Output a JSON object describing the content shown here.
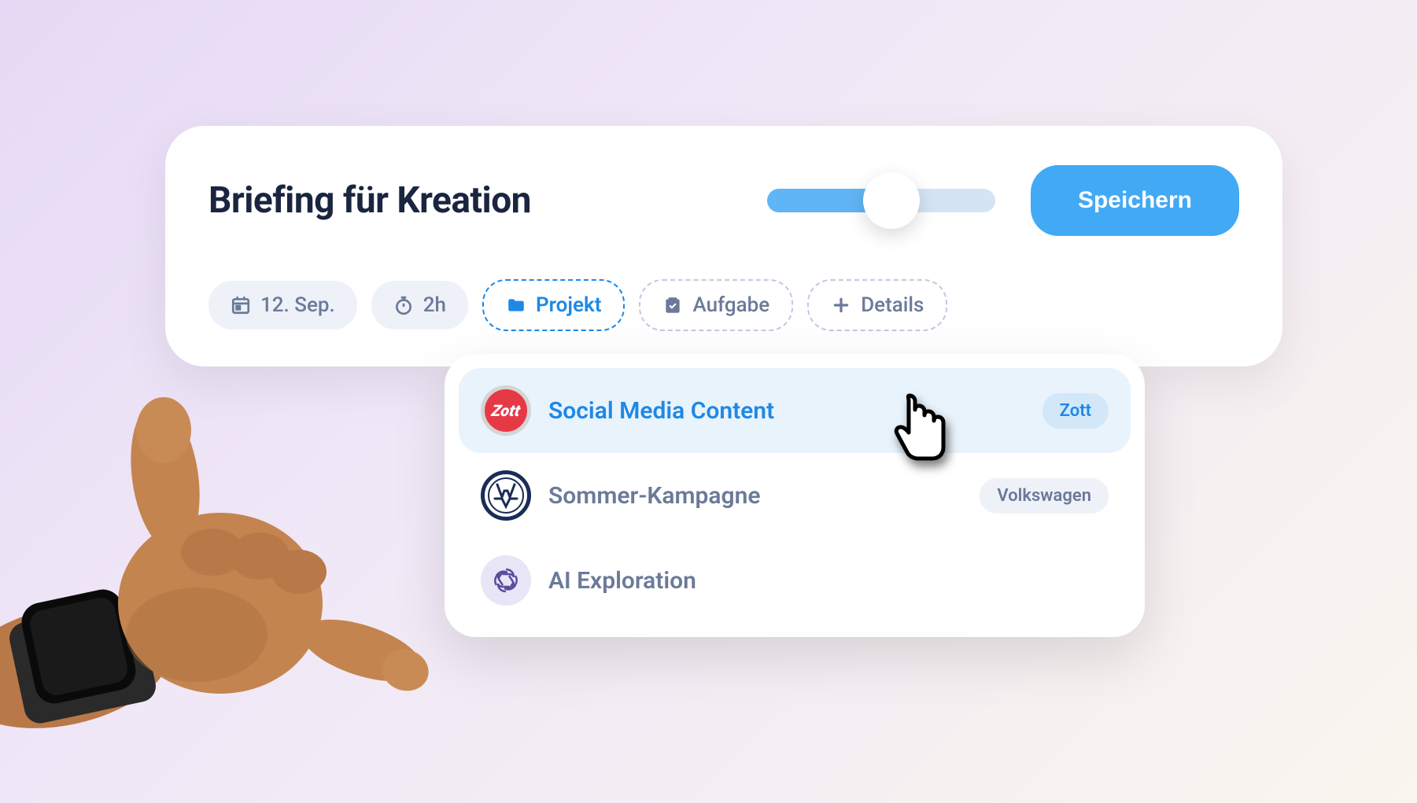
{
  "header": {
    "title": "Briefing für Kreation",
    "save_label": "Speichern"
  },
  "chips": {
    "date": {
      "label": "12. Sep."
    },
    "duration": {
      "label": "2h"
    },
    "project": {
      "label": "Projekt"
    },
    "task": {
      "label": "Aufgabe"
    },
    "details": {
      "label": "Details"
    }
  },
  "dropdown": {
    "items": [
      {
        "label": "Social Media Content",
        "badge": "Zott",
        "selected": true
      },
      {
        "label": "Sommer-Kampagne",
        "badge": "Volkswagen",
        "selected": false
      },
      {
        "label": "AI Exploration",
        "badge": "",
        "selected": false
      }
    ]
  }
}
